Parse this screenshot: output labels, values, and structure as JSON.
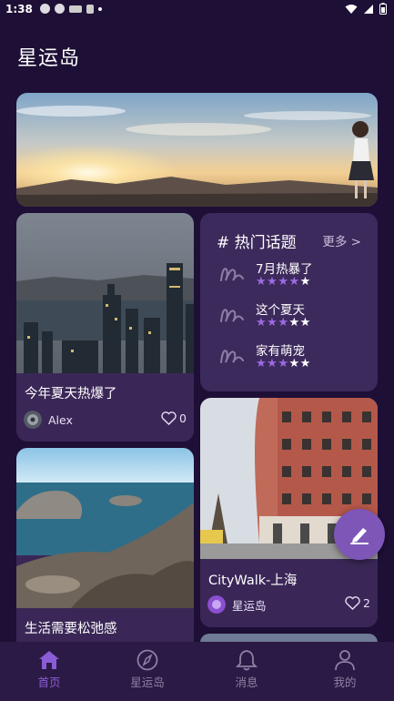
{
  "status_bar": {
    "time": "1:38"
  },
  "app_title": "星运岛",
  "posts": [
    {
      "caption": "今年夏天热爆了",
      "author": "Alex",
      "likes": "0"
    },
    {
      "caption": "CityWalk-上海",
      "author": "星运岛",
      "likes": "2"
    },
    {
      "caption": "生活需要松弛感"
    }
  ],
  "hot_topics": {
    "title": "# 热门话题",
    "more": "更多 >",
    "items": [
      {
        "name": "7月热暴了",
        "rating": 4
      },
      {
        "name": "这个夏天",
        "rating": 3
      },
      {
        "name": "家有萌宠",
        "rating": 3
      }
    ]
  },
  "bottom_nav": [
    {
      "label": "首页",
      "icon": "home-icon",
      "active": true
    },
    {
      "label": "星运岛",
      "icon": "compass-icon",
      "active": false
    },
    {
      "label": "消息",
      "icon": "bell-icon",
      "active": false
    },
    {
      "label": "我的",
      "icon": "user-icon",
      "active": false
    }
  ],
  "colors": {
    "background": "#1e0f36",
    "accent": "#8a5cd6",
    "card": "#3a2757",
    "star": "#9b6be3"
  }
}
